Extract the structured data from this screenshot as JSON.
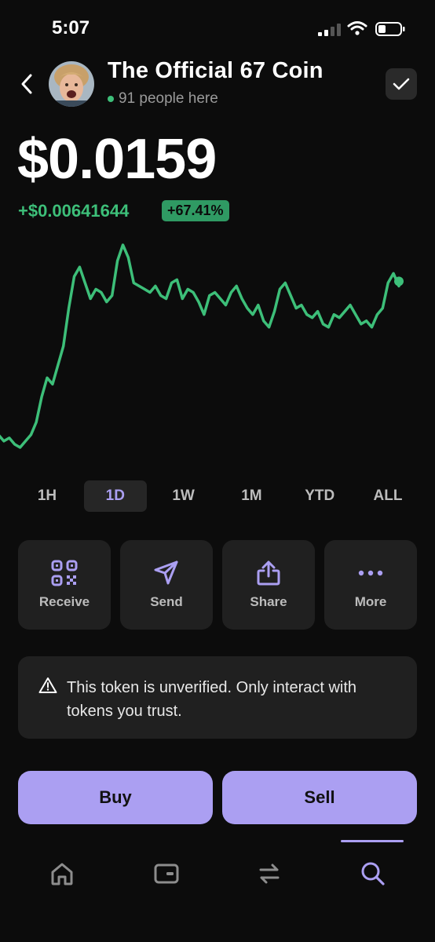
{
  "status_bar": {
    "time": "5:07"
  },
  "header": {
    "title": "The Official 67 Coin",
    "people": "91 people here"
  },
  "price": {
    "value": "$0.0159",
    "change": "+$0.00641644",
    "change_pct": "+67.41%"
  },
  "chart_data": {
    "type": "line",
    "series": [
      {
        "values": [
          0.0112,
          0.011,
          0.0111,
          0.0109,
          0.0108,
          0.011,
          0.0112,
          0.0116,
          0.0124,
          0.013,
          0.0128,
          0.0134,
          0.014,
          0.0152,
          0.0162,
          0.0165,
          0.016,
          0.0155,
          0.0158,
          0.0157,
          0.0154,
          0.0156,
          0.0167,
          0.0172,
          0.0168,
          0.016,
          0.0159,
          0.0158,
          0.0157,
          0.0159,
          0.0156,
          0.0155,
          0.016,
          0.0161,
          0.0155,
          0.0158,
          0.0157,
          0.0154,
          0.015,
          0.0156,
          0.0157,
          0.0155,
          0.0153,
          0.0157,
          0.0159,
          0.0155,
          0.0152,
          0.015,
          0.0153,
          0.0148,
          0.0146,
          0.0151,
          0.0158,
          0.016,
          0.0156,
          0.0152,
          0.0153,
          0.015,
          0.0149,
          0.0151,
          0.0147,
          0.0146,
          0.015,
          0.0149,
          0.0151,
          0.0153,
          0.015,
          0.0147,
          0.0148,
          0.0146,
          0.015,
          0.0152,
          0.016,
          0.0163,
          0.0159
        ]
      }
    ],
    "color": "#3dbf79"
  },
  "ranges": [
    "1H",
    "1D",
    "1W",
    "1M",
    "YTD",
    "ALL"
  ],
  "active_range": "1D",
  "actions": {
    "receive": "Receive",
    "send": "Send",
    "share": "Share",
    "more": "More"
  },
  "warning": {
    "text": "This token is unverified. Only interact with tokens you trust."
  },
  "buttons": {
    "buy": "Buy",
    "sell": "Sell"
  },
  "tabs": [
    {
      "icon": "home-icon"
    },
    {
      "icon": "wallet-card-icon"
    },
    {
      "icon": "swap-icon"
    },
    {
      "icon": "search-icon"
    }
  ],
  "colors": {
    "accent": "#ab9ff2",
    "positive": "#3dbf79",
    "background": "#0c0c0c",
    "card": "#202020"
  }
}
